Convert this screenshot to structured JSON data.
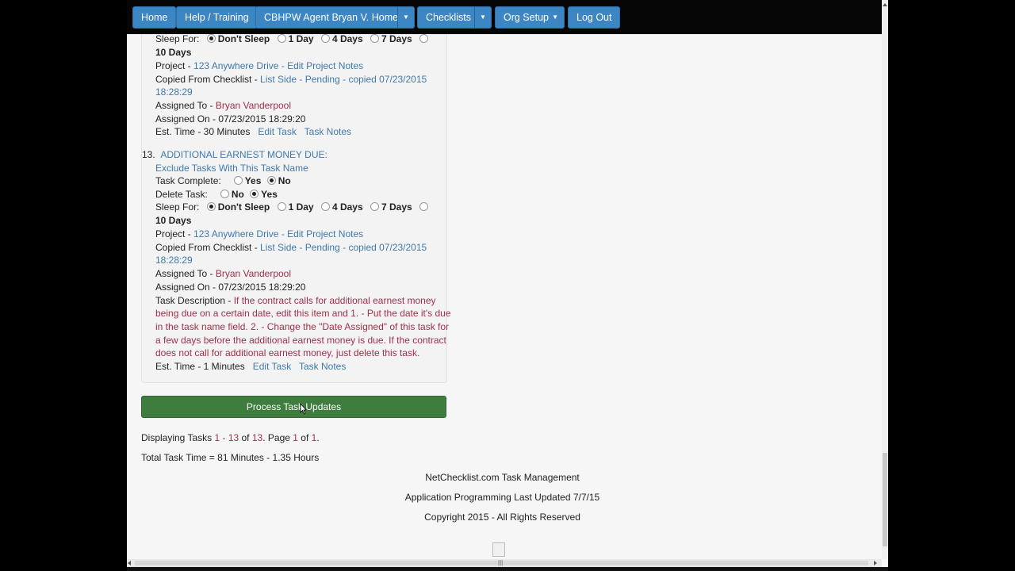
{
  "nav": {
    "home": "Home",
    "help": "Help / Training",
    "agent_home": "CBHPW Agent Bryan V. Home",
    "checklists": "Checklists",
    "org_setup": "Org Setup",
    "logout": "Log Out"
  },
  "task12": {
    "sleep_label": "Sleep For:",
    "sleep_options": [
      "Don't Sleep",
      "1 Day",
      "4 Days",
      "7 Days",
      "10 Days"
    ],
    "sleep_selected": "Don't Sleep",
    "project_label": "Project - ",
    "project_name": "123 Anywhere Drive",
    "project_sep": " - ",
    "edit_project_notes": "Edit Project Notes",
    "copied_label": "Copied From Checklist - ",
    "copied_value_1": "List Side - Pending - copied 07/23/2015",
    "copied_value_2": "18:28:29",
    "assigned_to_label": "Assigned To - ",
    "assigned_to": "Bryan Vanderpool",
    "assigned_on": "Assigned On - 07/23/2015 18:29:20",
    "est_time": "Est. Time - 30 Minutes",
    "edit_task": "Edit Task",
    "task_notes": "Task Notes"
  },
  "task13": {
    "number": "13.",
    "title": "ADDITIONAL EARNEST MONEY DUE:",
    "exclude_link": "Exclude Tasks With This Task Name",
    "complete_label": "Task Complete:",
    "complete_options": [
      "Yes",
      "No"
    ],
    "complete_selected": "No",
    "delete_label": "Delete Task:",
    "delete_options": [
      "No",
      "Yes"
    ],
    "delete_selected": "Yes",
    "sleep_label": "Sleep For:",
    "sleep_options": [
      "Don't Sleep",
      "1 Day",
      "4 Days",
      "7 Days",
      "10 Days"
    ],
    "sleep_selected": "Don't Sleep",
    "project_label": "Project - ",
    "project_name": "123 Anywhere Drive",
    "project_sep": " - ",
    "edit_project_notes": "Edit Project Notes",
    "copied_label": "Copied From Checklist - ",
    "copied_value_1": "List Side - Pending - copied 07/23/2015",
    "copied_value_2": "18:28:29",
    "assigned_to_label": "Assigned To - ",
    "assigned_to": "Bryan Vanderpool",
    "assigned_on": "Assigned On - 07/23/2015 18:29:20",
    "description_label": "Task Description - ",
    "description_lines": [
      "If the contract calls for additional earnest money",
      "being due on a certain date, edit this item and 1. - Put the date it's due",
      "in the task name field. 2. - Change the \"Date Assigned\" of this task for",
      "a few days before the additional earnest money is due. If the contract",
      "does not call for additional earnest money, just delete this task."
    ],
    "est_time": "Est. Time - 1 Minutes",
    "edit_task": "Edit Task",
    "task_notes": "Task Notes"
  },
  "process_button": "Process Task Updates",
  "summary": {
    "displaying_label": "Displaying Tasks ",
    "range": "1 - 13",
    "of_label": " of ",
    "total": "13",
    "page_label": ".  Page ",
    "page": "1",
    "page_of": " of ",
    "pages": "1",
    "period": ".",
    "total_time": "Total Task Time = 81 Minutes - 1.35 Hours"
  },
  "footer": {
    "line1": "NetChecklist.com Task Management",
    "line2": "Application Programming Last Updated 7/7/15",
    "line3": "Copyright 2015 - All Rights Reserved"
  }
}
